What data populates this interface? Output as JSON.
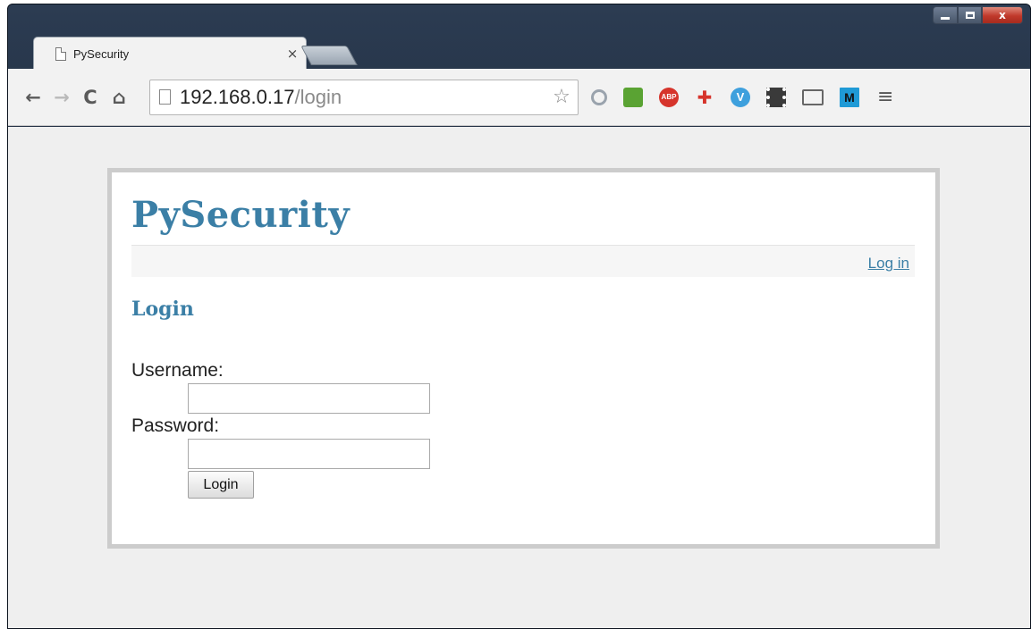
{
  "window": {
    "controls": {
      "minimize": "",
      "maximize": "",
      "close": "x"
    }
  },
  "tab": {
    "title": "PySecurity",
    "close": "×"
  },
  "toolbar": {
    "back": "←",
    "forward": "→",
    "reload": "C",
    "home": "⌂",
    "url_host": "192.168.0.17",
    "url_path": "/login",
    "bookmark": "☆",
    "extensions": [
      "search-extension",
      "evernote-extension",
      "adblock-plus-extension",
      "plus-extension",
      "v-extension",
      "film-extension",
      "cast-extension",
      "m-extension"
    ],
    "abp_label": "ABP",
    "plus_label": "✚",
    "v_label": "V",
    "m_label": "M",
    "menu": "≡"
  },
  "page": {
    "site_title": "PySecurity",
    "nav_link": "Log in",
    "heading": "Login",
    "username_label": "Username:",
    "password_label": "Password:",
    "username_value": "",
    "password_value": "",
    "submit_label": "Login"
  },
  "colors": {
    "accent": "#3b7fa6",
    "page_background": "#efefef",
    "card_border": "#cccccc"
  }
}
